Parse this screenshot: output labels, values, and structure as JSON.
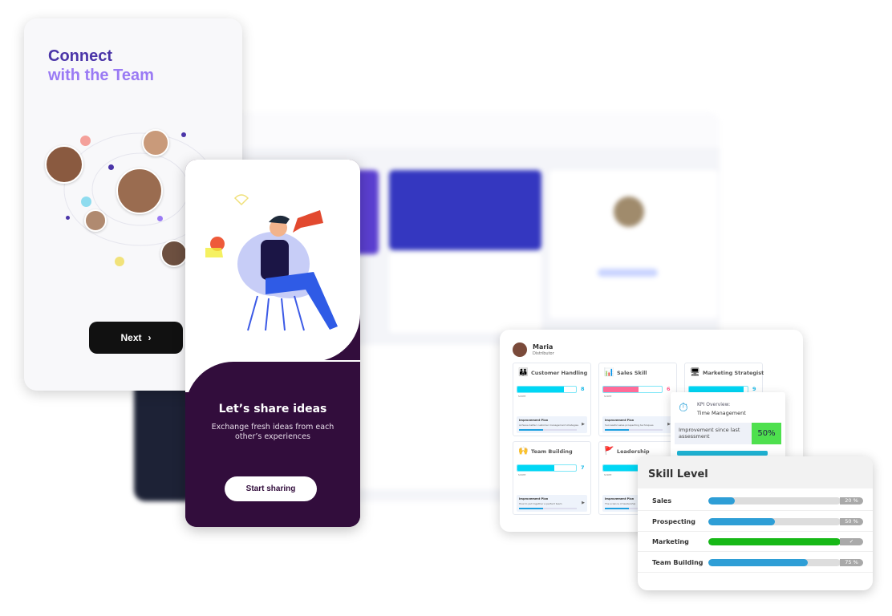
{
  "onboarding_connect": {
    "title_line1": "Connect",
    "title_line2": "with the Team",
    "next_label": "Next",
    "next_icon": "chevron-right-icon",
    "colors": {
      "title_dark": "#4b35a8",
      "title_light": "#9a7af4",
      "button": "#111111"
    }
  },
  "onboarding_share": {
    "title": "Let’s share ideas",
    "description": "Exchange fresh ideas from each other’s experiences",
    "button_label": "Start sharing",
    "colors": {
      "background": "#320d3c"
    }
  },
  "profile": {
    "name": "Maria",
    "role": "Distributor",
    "skills": [
      {
        "name": "Customer Handling",
        "score": 8,
        "score_label": "score",
        "progress": 0.8,
        "color": "#00d7f5",
        "plan_title": "Improvement Plan",
        "plan_desc": "Achieve better customer management strategies",
        "icon": "people-icon"
      },
      {
        "name": "Sales Skill",
        "score": 6,
        "score_label": "score",
        "progress": 0.6,
        "color": "#ff6b98",
        "plan_title": "Improvement Plan",
        "plan_desc": "Successful sales prospecting techniques",
        "icon": "bar-chart-icon"
      },
      {
        "name": "Marketing Strategist",
        "score": 9,
        "score_label": "score",
        "progress": 0.93,
        "color": "#00d7f5",
        "icon": "presentation-icon"
      },
      {
        "name": "Team Building",
        "score": 7,
        "score_label": "score",
        "progress": 0.63,
        "color": "#00d7f5",
        "plan_title": "Improvement Plan",
        "plan_desc": "How to put together a perfect team",
        "icon": "hands-icon"
      },
      {
        "name": "Leadership",
        "score_label": "score",
        "progress": 0.6,
        "color": "#00d7f5",
        "plan_title": "Improvement Plan",
        "plan_desc": "The science of leadership",
        "icon": "stairs-flag-icon"
      }
    ]
  },
  "kpi": {
    "label": "KPI Overview:",
    "metric": "Time Management",
    "improvement_label": "Improvement since last assessment",
    "improvement_value": "50%",
    "icon": "stopwatch-icon"
  },
  "skill_level": {
    "title": "Skill Level",
    "rows": [
      {
        "name": "Sales",
        "percent": 20,
        "label": "20 %",
        "color": "#2e9ed6"
      },
      {
        "name": "Prospecting",
        "percent": 50,
        "label": "50 %",
        "color": "#2e9ed6"
      },
      {
        "name": "Marketing",
        "percent": 100,
        "label": "✓",
        "color": "#17b817"
      },
      {
        "name": "Team Building",
        "percent": 75,
        "label": "75 %",
        "color": "#2e9ed6"
      }
    ]
  }
}
